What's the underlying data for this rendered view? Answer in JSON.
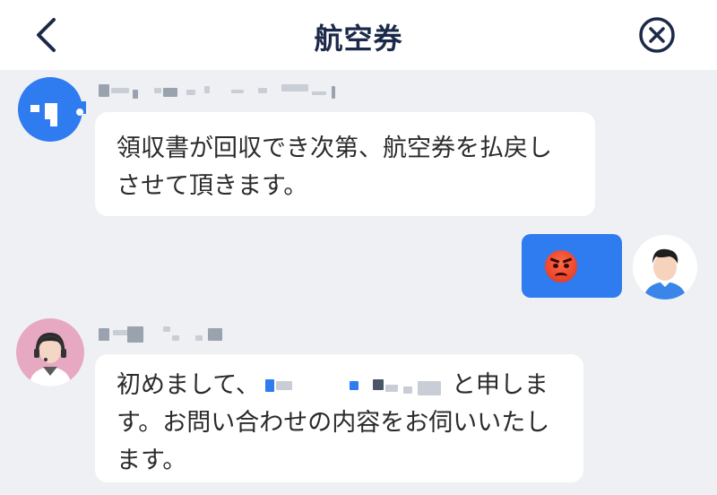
{
  "header": {
    "title": "航空券",
    "back_icon": "chevron-left-icon",
    "close_icon": "close-circle-icon"
  },
  "messages": [
    {
      "from": "bot",
      "text": "領収書が回収でき次第、航空券を払戻しさせて頂きます。"
    },
    {
      "from": "user",
      "emoji": "angry-face-emoji"
    },
    {
      "from": "agent",
      "text_before": "初めまして、",
      "text_after": "と申します。お問い合わせの内容をお伺いいたします。"
    }
  ],
  "colors": {
    "accent": "#2f7bf0",
    "title": "#1c2a4a",
    "background": "#eef0f4"
  }
}
